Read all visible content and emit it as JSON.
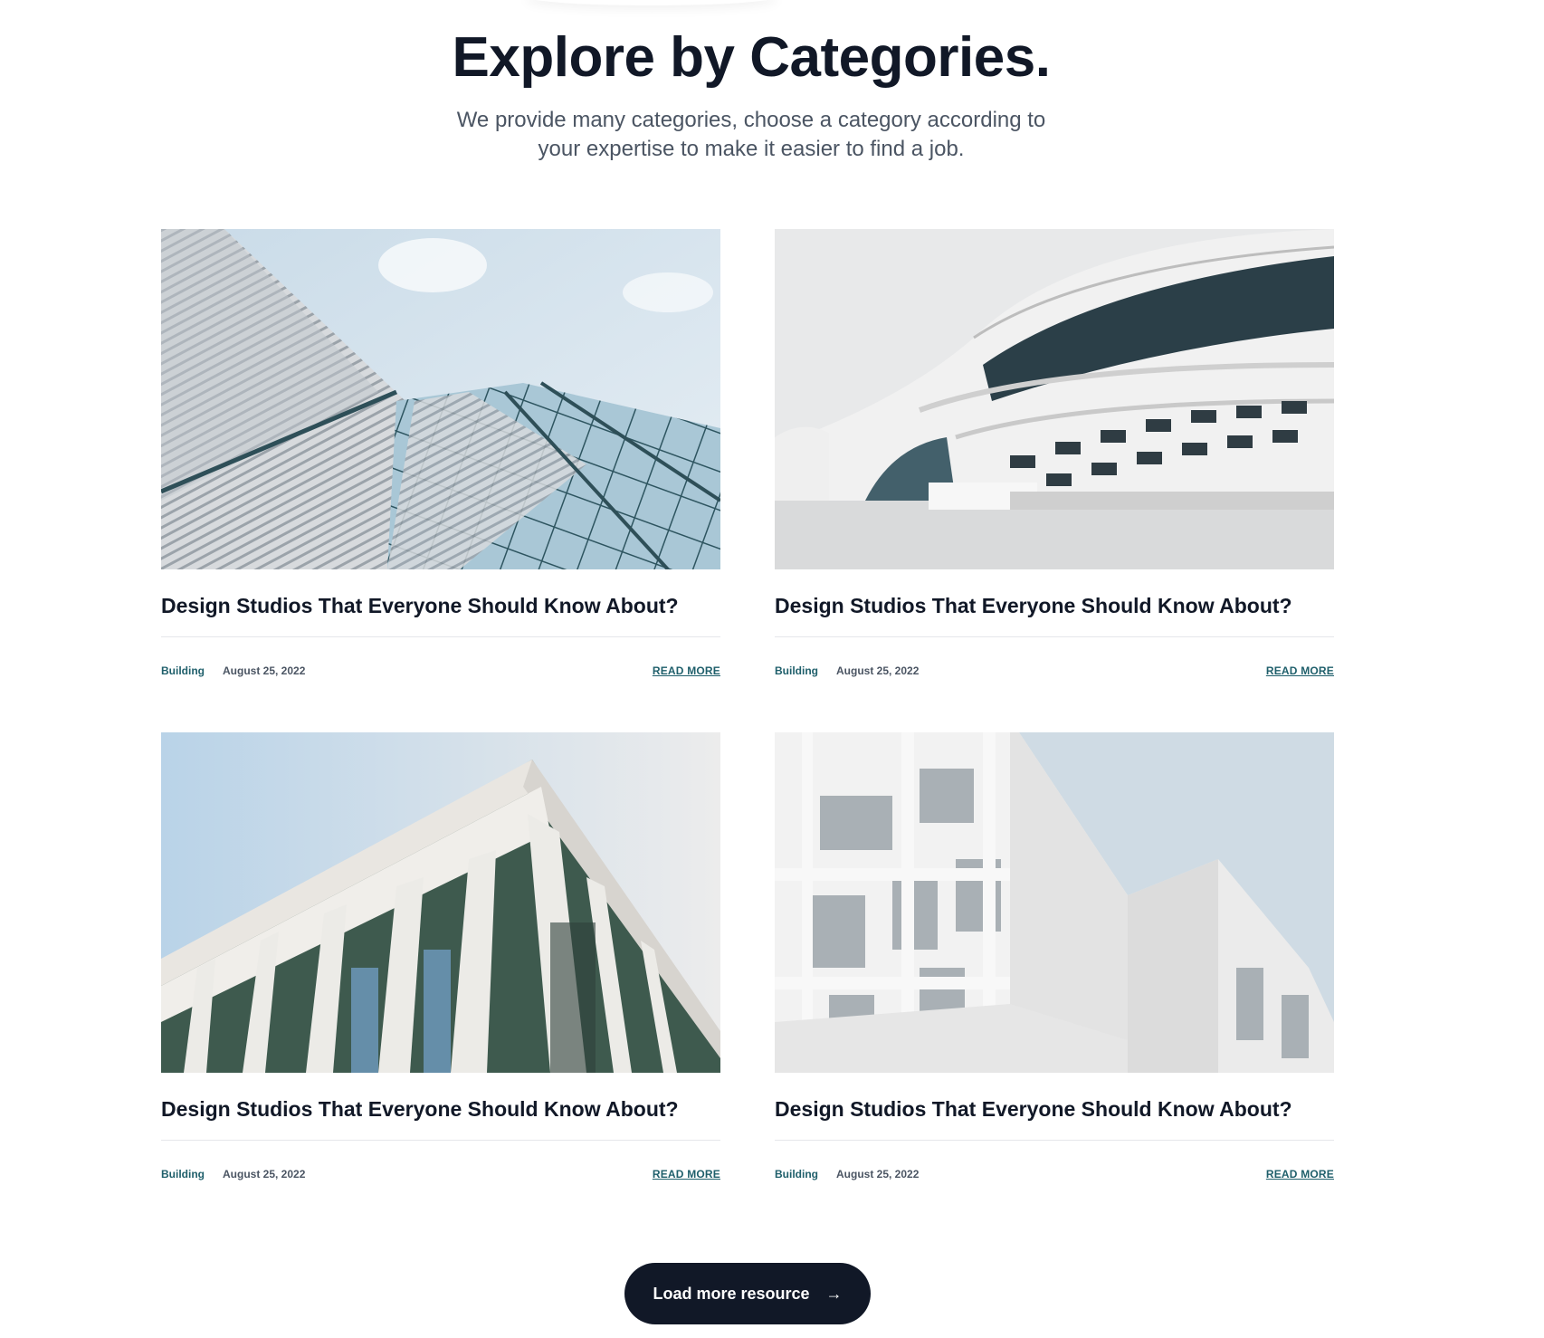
{
  "header": {
    "title": "Explore by Categories.",
    "subtitle": "We provide many categories, choose a category according to your expertise to make it easier to find a job."
  },
  "cards": [
    {
      "image": "glass-crystal-building-photo",
      "title": "Design Studios That Everyone Should Know About?",
      "category": "Building",
      "date": "August 25, 2022",
      "read_more": "READ MORE"
    },
    {
      "image": "curved-white-building-photo",
      "title": "Design Studios That Everyone Should Know About?",
      "category": "Building",
      "date": "August 25, 2022",
      "read_more": "READ MORE"
    },
    {
      "image": "columned-building-photo",
      "title": "Design Studios That Everyone Should Know About?",
      "category": "Building",
      "date": "August 25, 2022",
      "read_more": "READ MORE"
    },
    {
      "image": "white-cubic-building-photo",
      "title": "Design Studios That Everyone Should Know About?",
      "category": "Building",
      "date": "August 25, 2022",
      "read_more": "READ MORE"
    }
  ],
  "load_more": {
    "label": "Load more resource",
    "icon": "arrow-right-icon"
  },
  "colors": {
    "heading": "#111827",
    "accent": "#1f5f6b",
    "button_bg": "#111827"
  }
}
